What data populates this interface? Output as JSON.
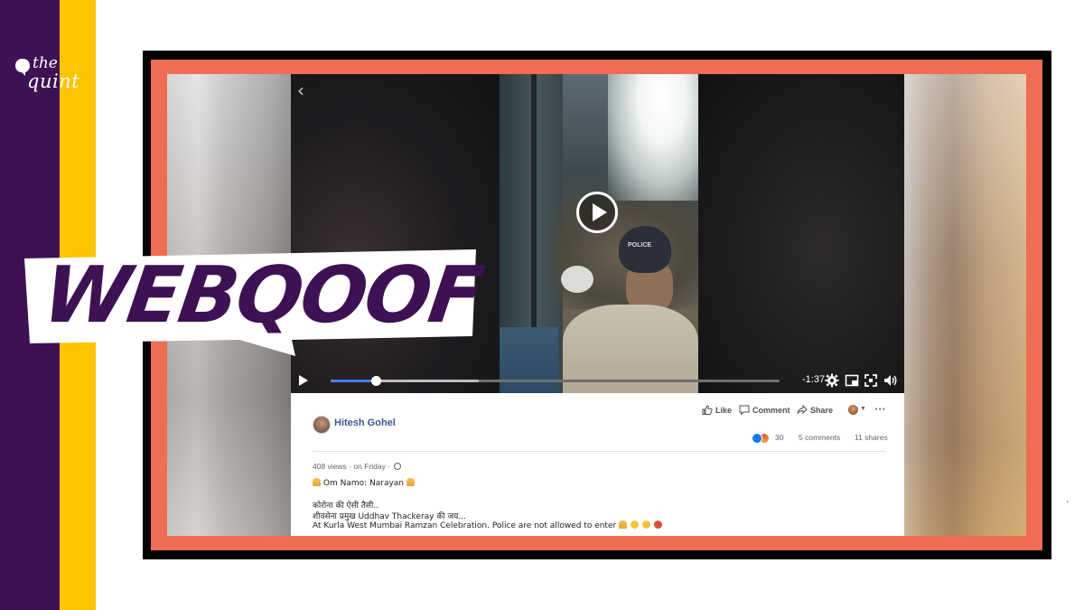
{
  "brand": {
    "logo_text_top": "the",
    "logo_text_bottom": "quint",
    "colors": {
      "purple": "#3e1153",
      "yellow": "#fdc400",
      "frame_orange": "#ef6d52",
      "frame_black": "#000000"
    }
  },
  "badge": {
    "label": "WEBQOOF",
    "text_color": "#3e1153",
    "background": "#ffffff"
  },
  "video": {
    "back_icon": "chevron-left-icon",
    "play_icon": "play-icon",
    "police_cap_text": "POLICE",
    "progress": {
      "played_fraction": 0.1,
      "buffered_fraction": 0.33
    },
    "time_remaining": "-1:37",
    "controls": [
      "play-icon",
      "settings-gear-icon",
      "mini-player-icon",
      "fullscreen-icon",
      "volume-icon"
    ]
  },
  "post": {
    "author": "Hitesh Gohel",
    "actions": {
      "like": "Like",
      "comment": "Comment",
      "share": "Share"
    },
    "reactions_count": "30",
    "comments_count": "5 comments",
    "shares_count": "11 shares",
    "views": "408 views",
    "time": "on Friday",
    "line1": "Om Namo: Narayan",
    "line2": "कोरोना की ऐसी तैसी..",
    "line3": "शीवसेना प्रमुख Uddhav Thackeray की जय...",
    "line4": "At Kurla West Mumbai Ramzan Celebration. Police are not allowed to enter"
  }
}
